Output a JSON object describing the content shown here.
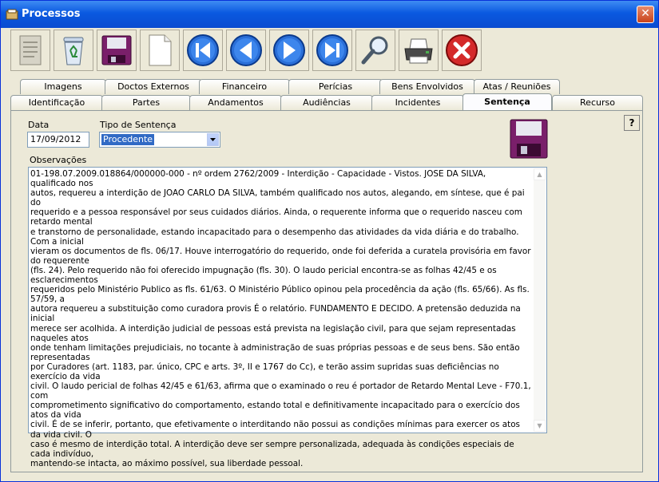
{
  "window": {
    "title": "Processos",
    "close_symbol": "✕"
  },
  "toolbar": {
    "buttons": [
      {
        "name": "document-list-icon"
      },
      {
        "name": "recycle-bin-icon"
      },
      {
        "name": "save-disk-icon"
      },
      {
        "name": "new-document-icon"
      },
      {
        "name": "first-record-icon"
      },
      {
        "name": "previous-record-icon"
      },
      {
        "name": "next-record-icon"
      },
      {
        "name": "last-record-icon"
      },
      {
        "name": "search-magnifier-icon"
      },
      {
        "name": "printer-icon"
      },
      {
        "name": "cancel-icon"
      }
    ]
  },
  "tabs": {
    "row1": [
      "Imagens",
      "Doctos Externos",
      "Financeiro",
      "Perícias",
      "Bens Envolvidos",
      "Atas / Reuniões"
    ],
    "row2": [
      "Identificação",
      "Partes",
      "Andamentos",
      "Audiências",
      "Incidentes",
      "Sentença",
      "Recurso"
    ],
    "active": "Sentença"
  },
  "form": {
    "data_label": "Data",
    "data_value": "17/09/2012",
    "tipo_label": "Tipo de Sentença",
    "tipo_value": "Procedente",
    "obs_label": "Observações",
    "obs_text": "01-198.07.2009.018864/000000-000 - nº ordem 2762/2009 - Interdição - Capacidade - Vistos. JOSE DA SILVA, qualificado nos\nautos, requereu a interdição de JOAO CARLO DA SILVA, também qualificado nos autos, alegando, em síntese, que é pai do\nrequerido e a pessoa responsável por seus cuidados diários. Ainda, o requerente informa que o requerido nasceu com retardo mental\ne transtorno de personalidade, estando incapacitado para o desempenho das atividades da vida diária e do trabalho. Com a inicial\nvieram os documentos de fls. 06/17. Houve interrogatório do requerido, onde foi deferida a curatela provisória em favor do requerente\n(fls. 24). Pelo requerido não foi oferecido impugnação (fls. 30). O laudo pericial encontra-se as folhas 42/45 e os esclarecimentos\nrequeridos pelo Ministério Publico as fls. 61/63. O Ministério Público opinou pela procedência da ação (fls. 65/66). As fls. 57/59, a\nautora requereu a substituição como curadora provis É o relatório. FUNDAMENTO E DECIDO. A pretensão deduzida na inicial\nmerece ser acolhida. A interdição judicial de pessoas está prevista na legislação civil, para que sejam representadas naqueles atos\nonde tenham limitações prejudiciais, no tocante à administração de suas próprias pessoas e de seus bens. São então representadas\npor Curadores (art. 1183, par. único, CPC e arts. 3º, II e 1767 do Cc), e terão assim supridas suas deficiências no exercício da vida\ncivil. O laudo pericial de folhas 42/45 e 61/63, afirma que o examinado o reu é portador de Retardo Mental Leve - F70.1, com\ncomprometimento significativo do comportamento, estando total e definitivamente incapacitado para o exercício dos atos da vida\ncivil. É de se inferir, portanto, que efetivamente o interditando não possui as condições mínimas para exercer os atos da vida civil. O\ncaso é mesmo de interdição total. A interdição deve ser sempre personalizada, adequada às condições especiais de cada indivíduo,\nmantendo-se intacta, ao máximo possível, sua liberdade pessoal.",
    "help_label": "?"
  },
  "colors": {
    "titlebar": "#0a59e0",
    "accent_blue": "#2a6fd8",
    "save_purple": "#7a1f6a",
    "cancel_red": "#d42a2a"
  }
}
